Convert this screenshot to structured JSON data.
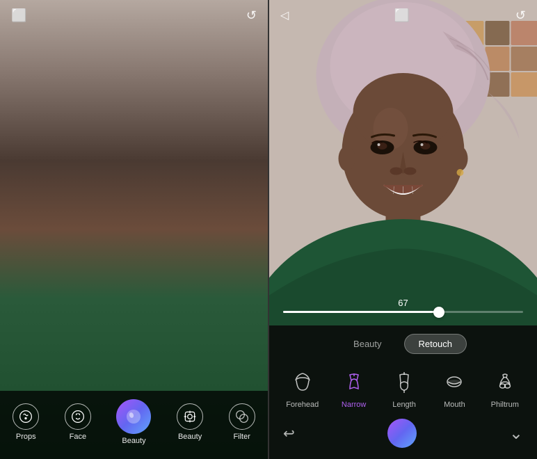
{
  "left_panel": {
    "top_icons": [
      "⬜",
      "🔄"
    ],
    "toolbar": {
      "items": [
        {
          "id": "props",
          "label": "Props",
          "icon": "props"
        },
        {
          "id": "face",
          "label": "Face",
          "icon": "face"
        },
        {
          "id": "beauty",
          "label": "Beauty",
          "icon": "beauty-gradient"
        },
        {
          "id": "beauty2",
          "label": "Beauty",
          "icon": "beauty"
        },
        {
          "id": "filter",
          "label": "Filter",
          "icon": "filter"
        }
      ]
    }
  },
  "right_panel": {
    "top_icons": [
      "◁",
      "⬜",
      "🔄"
    ],
    "slider": {
      "value": 67,
      "fill_percent": 65
    },
    "tabs": [
      {
        "id": "beauty",
        "label": "Beauty",
        "active": false
      },
      {
        "id": "retouch",
        "label": "Retouch",
        "active": true
      }
    ],
    "features": [
      {
        "id": "forehead",
        "label": "Forehead",
        "icon": "forehead",
        "active": false
      },
      {
        "id": "narrow",
        "label": "Narrow",
        "icon": "narrow",
        "active": true
      },
      {
        "id": "length",
        "label": "Length",
        "icon": "length",
        "active": false
      },
      {
        "id": "mouth",
        "label": "Mouth",
        "icon": "mouth",
        "active": false
      },
      {
        "id": "philtrum",
        "label": "Philtrum",
        "icon": "philtrum",
        "active": false
      }
    ],
    "bottom_actions": {
      "reset_icon": "↩",
      "chevron_icon": "⌄"
    }
  },
  "colors": {
    "accent": "#b060f0",
    "bg_dark": "rgba(10,10,10,0.88)",
    "slider_value": "67",
    "active_color": "#b060f0"
  }
}
